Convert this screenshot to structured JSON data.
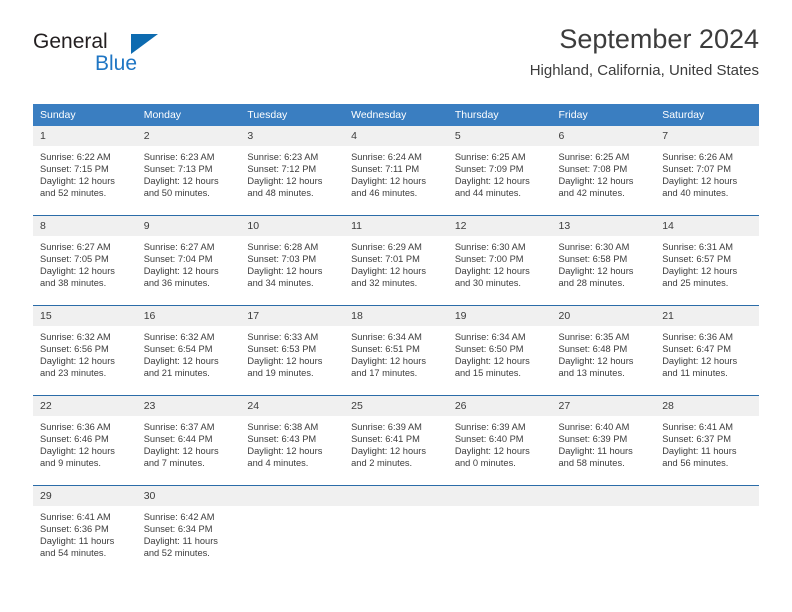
{
  "brand": {
    "name_part1": "General",
    "name_part2": "Blue",
    "logo_icon": "triangle-flag-icon",
    "accent_color": "#1f76c4"
  },
  "header": {
    "title": "September 2024",
    "subtitle": "Highland, California, United States"
  },
  "calendar": {
    "header_bg": "#3a7ec1",
    "daynum_bg": "#f0f0f0",
    "row_separator_color": "#2b6ca8",
    "weekdays": [
      "Sunday",
      "Monday",
      "Tuesday",
      "Wednesday",
      "Thursday",
      "Friday",
      "Saturday"
    ],
    "weeks": [
      [
        {
          "day": "1",
          "sunrise": "Sunrise: 6:22 AM",
          "sunset": "Sunset: 7:15 PM",
          "daylight_line1": "Daylight: 12 hours",
          "daylight_line2": "and 52 minutes."
        },
        {
          "day": "2",
          "sunrise": "Sunrise: 6:23 AM",
          "sunset": "Sunset: 7:13 PM",
          "daylight_line1": "Daylight: 12 hours",
          "daylight_line2": "and 50 minutes."
        },
        {
          "day": "3",
          "sunrise": "Sunrise: 6:23 AM",
          "sunset": "Sunset: 7:12 PM",
          "daylight_line1": "Daylight: 12 hours",
          "daylight_line2": "and 48 minutes."
        },
        {
          "day": "4",
          "sunrise": "Sunrise: 6:24 AM",
          "sunset": "Sunset: 7:11 PM",
          "daylight_line1": "Daylight: 12 hours",
          "daylight_line2": "and 46 minutes."
        },
        {
          "day": "5",
          "sunrise": "Sunrise: 6:25 AM",
          "sunset": "Sunset: 7:09 PM",
          "daylight_line1": "Daylight: 12 hours",
          "daylight_line2": "and 44 minutes."
        },
        {
          "day": "6",
          "sunrise": "Sunrise: 6:25 AM",
          "sunset": "Sunset: 7:08 PM",
          "daylight_line1": "Daylight: 12 hours",
          "daylight_line2": "and 42 minutes."
        },
        {
          "day": "7",
          "sunrise": "Sunrise: 6:26 AM",
          "sunset": "Sunset: 7:07 PM",
          "daylight_line1": "Daylight: 12 hours",
          "daylight_line2": "and 40 minutes."
        }
      ],
      [
        {
          "day": "8",
          "sunrise": "Sunrise: 6:27 AM",
          "sunset": "Sunset: 7:05 PM",
          "daylight_line1": "Daylight: 12 hours",
          "daylight_line2": "and 38 minutes."
        },
        {
          "day": "9",
          "sunrise": "Sunrise: 6:27 AM",
          "sunset": "Sunset: 7:04 PM",
          "daylight_line1": "Daylight: 12 hours",
          "daylight_line2": "and 36 minutes."
        },
        {
          "day": "10",
          "sunrise": "Sunrise: 6:28 AM",
          "sunset": "Sunset: 7:03 PM",
          "daylight_line1": "Daylight: 12 hours",
          "daylight_line2": "and 34 minutes."
        },
        {
          "day": "11",
          "sunrise": "Sunrise: 6:29 AM",
          "sunset": "Sunset: 7:01 PM",
          "daylight_line1": "Daylight: 12 hours",
          "daylight_line2": "and 32 minutes."
        },
        {
          "day": "12",
          "sunrise": "Sunrise: 6:30 AM",
          "sunset": "Sunset: 7:00 PM",
          "daylight_line1": "Daylight: 12 hours",
          "daylight_line2": "and 30 minutes."
        },
        {
          "day": "13",
          "sunrise": "Sunrise: 6:30 AM",
          "sunset": "Sunset: 6:58 PM",
          "daylight_line1": "Daylight: 12 hours",
          "daylight_line2": "and 28 minutes."
        },
        {
          "day": "14",
          "sunrise": "Sunrise: 6:31 AM",
          "sunset": "Sunset: 6:57 PM",
          "daylight_line1": "Daylight: 12 hours",
          "daylight_line2": "and 25 minutes."
        }
      ],
      [
        {
          "day": "15",
          "sunrise": "Sunrise: 6:32 AM",
          "sunset": "Sunset: 6:56 PM",
          "daylight_line1": "Daylight: 12 hours",
          "daylight_line2": "and 23 minutes."
        },
        {
          "day": "16",
          "sunrise": "Sunrise: 6:32 AM",
          "sunset": "Sunset: 6:54 PM",
          "daylight_line1": "Daylight: 12 hours",
          "daylight_line2": "and 21 minutes."
        },
        {
          "day": "17",
          "sunrise": "Sunrise: 6:33 AM",
          "sunset": "Sunset: 6:53 PM",
          "daylight_line1": "Daylight: 12 hours",
          "daylight_line2": "and 19 minutes."
        },
        {
          "day": "18",
          "sunrise": "Sunrise: 6:34 AM",
          "sunset": "Sunset: 6:51 PM",
          "daylight_line1": "Daylight: 12 hours",
          "daylight_line2": "and 17 minutes."
        },
        {
          "day": "19",
          "sunrise": "Sunrise: 6:34 AM",
          "sunset": "Sunset: 6:50 PM",
          "daylight_line1": "Daylight: 12 hours",
          "daylight_line2": "and 15 minutes."
        },
        {
          "day": "20",
          "sunrise": "Sunrise: 6:35 AM",
          "sunset": "Sunset: 6:48 PM",
          "daylight_line1": "Daylight: 12 hours",
          "daylight_line2": "and 13 minutes."
        },
        {
          "day": "21",
          "sunrise": "Sunrise: 6:36 AM",
          "sunset": "Sunset: 6:47 PM",
          "daylight_line1": "Daylight: 12 hours",
          "daylight_line2": "and 11 minutes."
        }
      ],
      [
        {
          "day": "22",
          "sunrise": "Sunrise: 6:36 AM",
          "sunset": "Sunset: 6:46 PM",
          "daylight_line1": "Daylight: 12 hours",
          "daylight_line2": "and 9 minutes."
        },
        {
          "day": "23",
          "sunrise": "Sunrise: 6:37 AM",
          "sunset": "Sunset: 6:44 PM",
          "daylight_line1": "Daylight: 12 hours",
          "daylight_line2": "and 7 minutes."
        },
        {
          "day": "24",
          "sunrise": "Sunrise: 6:38 AM",
          "sunset": "Sunset: 6:43 PM",
          "daylight_line1": "Daylight: 12 hours",
          "daylight_line2": "and 4 minutes."
        },
        {
          "day": "25",
          "sunrise": "Sunrise: 6:39 AM",
          "sunset": "Sunset: 6:41 PM",
          "daylight_line1": "Daylight: 12 hours",
          "daylight_line2": "and 2 minutes."
        },
        {
          "day": "26",
          "sunrise": "Sunrise: 6:39 AM",
          "sunset": "Sunset: 6:40 PM",
          "daylight_line1": "Daylight: 12 hours",
          "daylight_line2": "and 0 minutes."
        },
        {
          "day": "27",
          "sunrise": "Sunrise: 6:40 AM",
          "sunset": "Sunset: 6:39 PM",
          "daylight_line1": "Daylight: 11 hours",
          "daylight_line2": "and 58 minutes."
        },
        {
          "day": "28",
          "sunrise": "Sunrise: 6:41 AM",
          "sunset": "Sunset: 6:37 PM",
          "daylight_line1": "Daylight: 11 hours",
          "daylight_line2": "and 56 minutes."
        }
      ],
      [
        {
          "day": "29",
          "sunrise": "Sunrise: 6:41 AM",
          "sunset": "Sunset: 6:36 PM",
          "daylight_line1": "Daylight: 11 hours",
          "daylight_line2": "and 54 minutes."
        },
        {
          "day": "30",
          "sunrise": "Sunrise: 6:42 AM",
          "sunset": "Sunset: 6:34 PM",
          "daylight_line1": "Daylight: 11 hours",
          "daylight_line2": "and 52 minutes."
        },
        {
          "day": "",
          "sunrise": "",
          "sunset": "",
          "daylight_line1": "",
          "daylight_line2": ""
        },
        {
          "day": "",
          "sunrise": "",
          "sunset": "",
          "daylight_line1": "",
          "daylight_line2": ""
        },
        {
          "day": "",
          "sunrise": "",
          "sunset": "",
          "daylight_line1": "",
          "daylight_line2": ""
        },
        {
          "day": "",
          "sunrise": "",
          "sunset": "",
          "daylight_line1": "",
          "daylight_line2": ""
        },
        {
          "day": "",
          "sunrise": "",
          "sunset": "",
          "daylight_line1": "",
          "daylight_line2": ""
        }
      ]
    ]
  }
}
